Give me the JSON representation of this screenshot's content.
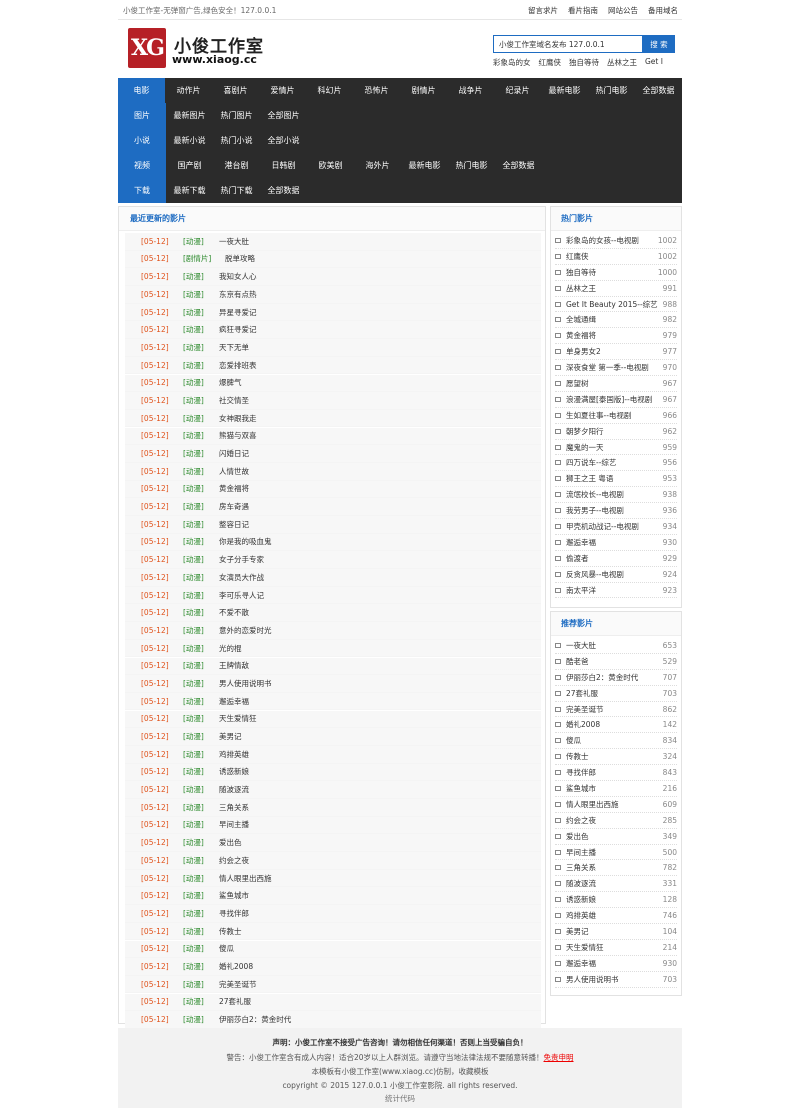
{
  "topbar": {
    "notice": "小俊工作室-无弹窗广告,绿色安全！127.0.0.1",
    "links": [
      "留言求片",
      "看片指南",
      "网站公告",
      "备用域名"
    ]
  },
  "logo": {
    "cn": "小俊工作室",
    "url": "www.xiaog.cc",
    "mark": "XG"
  },
  "search": {
    "value": "小俊工作室域名发布 127.0.0.1",
    "button": "搜 索",
    "hotwords": [
      "彩象岛的女",
      "红鹰侠",
      "独自等待",
      "丛林之王",
      "Get I"
    ]
  },
  "nav": [
    {
      "cat": "电影",
      "items": [
        "动作片",
        "喜剧片",
        "爱情片",
        "科幻片",
        "恐怖片",
        "剧情片",
        "战争片",
        "纪录片",
        "最新电影",
        "热门电影",
        "全部数据"
      ]
    },
    {
      "cat": "图片",
      "items": [
        "最新图片",
        "热门图片",
        "全部图片"
      ]
    },
    {
      "cat": "小说",
      "items": [
        "最新小说",
        "热门小说",
        "全部小说"
      ]
    },
    {
      "cat": "视频",
      "items": [
        "国产剧",
        "港台剧",
        "日韩剧",
        "欧美剧",
        "海外片",
        "最新电影",
        "热门电影",
        "全部数据"
      ]
    },
    {
      "cat": "下载",
      "items": [
        "最新下载",
        "热门下载",
        "全部数据"
      ]
    }
  ],
  "latest": {
    "title": "最近更新的影片",
    "rows": [
      {
        "date": "[05-12]",
        "genre": "[动漫]",
        "title": "一夜大肚"
      },
      {
        "date": "[05-12]",
        "genre": "[剧情片]",
        "title": "脱单攻略"
      },
      {
        "date": "[05-12]",
        "genre": "[动漫]",
        "title": "我知女人心"
      },
      {
        "date": "[05-12]",
        "genre": "[动漫]",
        "title": "东京有点热"
      },
      {
        "date": "[05-12]",
        "genre": "[动漫]",
        "title": "异星寻爱记"
      },
      {
        "date": "[05-12]",
        "genre": "[动漫]",
        "title": "疯狂寻爱记"
      },
      {
        "date": "[05-12]",
        "genre": "[动漫]",
        "title": "天下无单"
      },
      {
        "date": "[05-12]",
        "genre": "[动漫]",
        "title": "恋爱排班表"
      },
      {
        "date": "[05-12]",
        "genre": "[动漫]",
        "title": "爆脾气"
      },
      {
        "date": "[05-12]",
        "genre": "[动漫]",
        "title": "社交情圣"
      },
      {
        "date": "[05-12]",
        "genre": "[动漫]",
        "title": "女神跟我走"
      },
      {
        "date": "[05-12]",
        "genre": "[动漫]",
        "title": "熊猫与双喜"
      },
      {
        "date": "[05-12]",
        "genre": "[动漫]",
        "title": "闪婚日记"
      },
      {
        "date": "[05-12]",
        "genre": "[动漫]",
        "title": "人情世故"
      },
      {
        "date": "[05-12]",
        "genre": "[动漫]",
        "title": "黄金福将"
      },
      {
        "date": "[05-12]",
        "genre": "[动漫]",
        "title": "房车奇遇"
      },
      {
        "date": "[05-12]",
        "genre": "[动漫]",
        "title": "整容日记"
      },
      {
        "date": "[05-12]",
        "genre": "[动漫]",
        "title": "你是我的吸血鬼"
      },
      {
        "date": "[05-12]",
        "genre": "[动漫]",
        "title": "女子分手专家"
      },
      {
        "date": "[05-12]",
        "genre": "[动漫]",
        "title": "女演员大作战"
      },
      {
        "date": "[05-12]",
        "genre": "[动漫]",
        "title": "李可乐寻人记"
      },
      {
        "date": "[05-12]",
        "genre": "[动漫]",
        "title": "不爱不散"
      },
      {
        "date": "[05-12]",
        "genre": "[动漫]",
        "title": "意外的恋爱时光"
      },
      {
        "date": "[05-12]",
        "genre": "[动漫]",
        "title": "光的棍"
      },
      {
        "date": "[05-12]",
        "genre": "[动漫]",
        "title": "王牌情敌"
      },
      {
        "date": "[05-12]",
        "genre": "[动漫]",
        "title": "男人使用说明书"
      },
      {
        "date": "[05-12]",
        "genre": "[动漫]",
        "title": "邂逅幸福"
      },
      {
        "date": "[05-12]",
        "genre": "[动漫]",
        "title": "天生爱情狂"
      },
      {
        "date": "[05-12]",
        "genre": "[动漫]",
        "title": "美男记"
      },
      {
        "date": "[05-12]",
        "genre": "[动漫]",
        "title": "鸡排英雄"
      },
      {
        "date": "[05-12]",
        "genre": "[动漫]",
        "title": "诱惑新娘"
      },
      {
        "date": "[05-12]",
        "genre": "[动漫]",
        "title": "随波逐流"
      },
      {
        "date": "[05-12]",
        "genre": "[动漫]",
        "title": "三角关系"
      },
      {
        "date": "[05-12]",
        "genre": "[动漫]",
        "title": "早间主播"
      },
      {
        "date": "[05-12]",
        "genre": "[动漫]",
        "title": "爱出色"
      },
      {
        "date": "[05-12]",
        "genre": "[动漫]",
        "title": "约会之夜"
      },
      {
        "date": "[05-12]",
        "genre": "[动漫]",
        "title": "情人眼里出西施"
      },
      {
        "date": "[05-12]",
        "genre": "[动漫]",
        "title": "鲨鱼城市"
      },
      {
        "date": "[05-12]",
        "genre": "[动漫]",
        "title": "寻找伴郎"
      },
      {
        "date": "[05-12]",
        "genre": "[动漫]",
        "title": "传教士"
      },
      {
        "date": "[05-12]",
        "genre": "[动漫]",
        "title": "傻瓜"
      },
      {
        "date": "[05-12]",
        "genre": "[动漫]",
        "title": "婚礼2008"
      },
      {
        "date": "[05-12]",
        "genre": "[动漫]",
        "title": "完美圣诞节"
      },
      {
        "date": "[05-12]",
        "genre": "[动漫]",
        "title": "27套礼服"
      },
      {
        "date": "[05-12]",
        "genre": "[动漫]",
        "title": "伊丽莎白2：黄金时代"
      }
    ]
  },
  "hot": {
    "title": "热门影片",
    "items": [
      {
        "name": "彩象岛的女孩--电视剧",
        "count": "1002"
      },
      {
        "name": "红鹰侠",
        "count": "1002"
      },
      {
        "name": "独自等待",
        "count": "1000"
      },
      {
        "name": "丛林之王",
        "count": "991"
      },
      {
        "name": "Get It Beauty 2015--综艺",
        "count": "988"
      },
      {
        "name": "全城通缉",
        "count": "982"
      },
      {
        "name": "黄金福将",
        "count": "979"
      },
      {
        "name": "单身男女2",
        "count": "977"
      },
      {
        "name": "深夜食堂 第一季--电视剧",
        "count": "970"
      },
      {
        "name": "愿望树",
        "count": "967"
      },
      {
        "name": "浪漫满屋[泰国版]--电视剧",
        "count": "967"
      },
      {
        "name": "生如夏往事--电视剧",
        "count": "966"
      },
      {
        "name": "朝梦夕阳行",
        "count": "962"
      },
      {
        "name": "魔鬼的一天",
        "count": "959"
      },
      {
        "name": "四万说车--综艺",
        "count": "956"
      },
      {
        "name": "狮王之王 粤语",
        "count": "953"
      },
      {
        "name": "流氓校长--电视剧",
        "count": "938"
      },
      {
        "name": "我劳男子--电视剧",
        "count": "936"
      },
      {
        "name": "甲壳机动战记--电视剧",
        "count": "934"
      },
      {
        "name": "邂逅幸福",
        "count": "930"
      },
      {
        "name": "偷渡者",
        "count": "929"
      },
      {
        "name": "反贪风暴--电视剧",
        "count": "924"
      },
      {
        "name": "南太平洋",
        "count": "923"
      }
    ]
  },
  "recommend": {
    "title": "推荐影片",
    "items": [
      {
        "name": "一夜大肚",
        "count": "653"
      },
      {
        "name": "酷老爸",
        "count": "529"
      },
      {
        "name": "伊丽莎白2：黄金时代",
        "count": "707"
      },
      {
        "name": "27套礼服",
        "count": "703"
      },
      {
        "name": "完美圣诞节",
        "count": "862"
      },
      {
        "name": "婚礼2008",
        "count": "142"
      },
      {
        "name": "傻瓜",
        "count": "834"
      },
      {
        "name": "传教士",
        "count": "324"
      },
      {
        "name": "寻找伴郎",
        "count": "843"
      },
      {
        "name": "鲨鱼城市",
        "count": "216"
      },
      {
        "name": "情人眼里出西施",
        "count": "609"
      },
      {
        "name": "约会之夜",
        "count": "285"
      },
      {
        "name": "爱出色",
        "count": "349"
      },
      {
        "name": "早间主播",
        "count": "500"
      },
      {
        "name": "三角关系",
        "count": "782"
      },
      {
        "name": "随波逐流",
        "count": "331"
      },
      {
        "name": "诱惑新娘",
        "count": "128"
      },
      {
        "name": "鸡排英雄",
        "count": "746"
      },
      {
        "name": "美男记",
        "count": "104"
      },
      {
        "name": "天生爱情狂",
        "count": "214"
      },
      {
        "name": "邂逅幸福",
        "count": "930"
      },
      {
        "name": "男人使用说明书",
        "count": "703"
      }
    ]
  },
  "footer": {
    "line1": "声明：小俊工作室不接受广告咨询！请勿相信任何渠道！否则上当受骗自负！",
    "line2": "警告：小俊工作室含有成人内容！适合20岁以上人群浏览。请遵守当地法律法规不要随意转播！",
    "line2_red": "免责申明",
    "line3": "本模板有小俊工作室(www.xiaog.cc)仿制，收藏模板",
    "line4": "copyright © 2015 127.0.0.1 小俊工作室影院. all rights reserved.",
    "line5": "统计代码"
  },
  "colors": {
    "accent": "#1e6cc2",
    "nav_bg": "#2b2b2b",
    "date": "#e0531c",
    "genre": "#2e8b2e",
    "logo": "#b62026"
  }
}
